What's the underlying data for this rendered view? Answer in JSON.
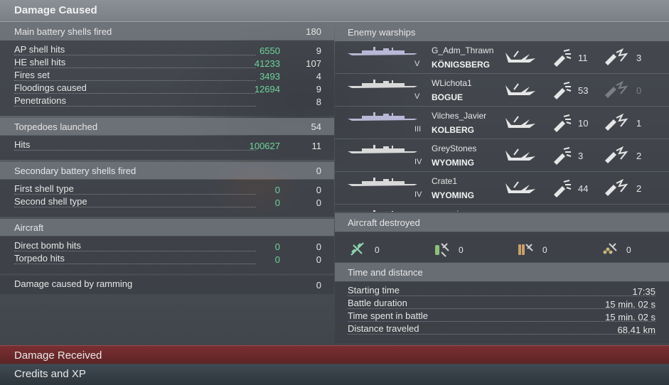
{
  "header": {
    "title": "Damage Caused"
  },
  "main_battery": {
    "title": "Main battery shells fired",
    "total": "180",
    "rows": [
      {
        "label": "AP shell hits",
        "damage": "6550",
        "count": "9"
      },
      {
        "label": "HE shell hits",
        "damage": "41233",
        "count": "107"
      },
      {
        "label": "Fires set",
        "damage": "3493",
        "count": "4"
      },
      {
        "label": "Floodings caused",
        "damage": "12694",
        "count": "9"
      },
      {
        "label": "Penetrations",
        "damage": "",
        "count": "8"
      }
    ]
  },
  "torpedoes": {
    "title": "Torpedoes launched",
    "total": "54",
    "rows": [
      {
        "label": "Hits",
        "damage": "100627",
        "count": "11"
      }
    ]
  },
  "secondary": {
    "title": "Secondary battery shells fired",
    "total": "0",
    "rows": [
      {
        "label": "First shell type",
        "damage": "0",
        "count": "0"
      },
      {
        "label": "Second shell type",
        "damage": "0",
        "count": "0"
      }
    ]
  },
  "aircraft": {
    "title": "Aircraft",
    "rows": [
      {
        "label": "Direct bomb hits",
        "damage": "0",
        "count": "0"
      },
      {
        "label": "Torpedo hits",
        "damage": "0",
        "count": "0"
      }
    ]
  },
  "ramming": {
    "label": "Damage caused by ramming",
    "value": "0"
  },
  "enemy": {
    "title": "Enemy warships",
    "ships": [
      {
        "player": "G_Adm_Thrawn",
        "ship": "KÖNIGSBERG",
        "tier": "V",
        "hits": "11",
        "citadels": "3",
        "citadel_dim": false,
        "color": "#b9b7d6"
      },
      {
        "player": "WLichota1",
        "ship": "BOGUE",
        "tier": "V",
        "hits": "53",
        "citadels": "0",
        "citadel_dim": true,
        "color": "#d9d9d9"
      },
      {
        "player": "Vilches_Javier",
        "ship": "KOLBERG",
        "tier": "III",
        "hits": "10",
        "citadels": "1",
        "citadel_dim": false,
        "color": "#b9b7d6"
      },
      {
        "player": "GreyStones",
        "ship": "WYOMING",
        "tier": "IV",
        "hits": "3",
        "citadels": "2",
        "citadel_dim": false,
        "color": "#d9d9d9"
      },
      {
        "player": "Crate1",
        "ship": "WYOMING",
        "tier": "IV",
        "hits": "44",
        "citadels": "2",
        "citadel_dim": false,
        "color": "#d9d9d9"
      },
      {
        "player": "mcsquigs",
        "ship": "",
        "tier": "",
        "hits": "",
        "citadels": "",
        "citadel_dim": false,
        "color": "#d9d9d9"
      }
    ]
  },
  "aircraft_destroyed": {
    "title": "Aircraft destroyed",
    "items": [
      {
        "icon": "fighter-icon",
        "value": "0"
      },
      {
        "icon": "torpedo-bomber-icon",
        "value": "0"
      },
      {
        "icon": "dive-bomber-icon",
        "value": "0"
      },
      {
        "icon": "scout-plane-icon",
        "value": "0"
      }
    ]
  },
  "time": {
    "title": "Time and distance",
    "rows": [
      {
        "label": "Starting time",
        "value": "17:35"
      },
      {
        "label": "Battle duration",
        "value": "15 min. 02 s"
      },
      {
        "label": "Time spent in battle",
        "value": "15 min. 02 s"
      },
      {
        "label": "Distance traveled",
        "value": "68.41 km"
      }
    ]
  },
  "tabs": {
    "received": "Damage Received",
    "credits": "Credits and XP"
  },
  "colors": {
    "damage_value": "#6fd39a",
    "received_bar": "#6b2a2c"
  }
}
